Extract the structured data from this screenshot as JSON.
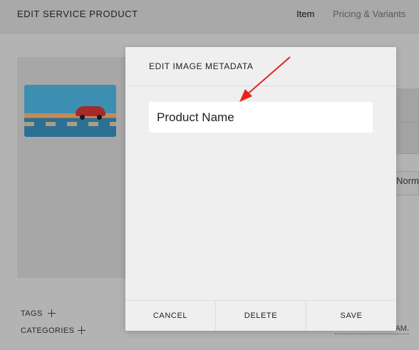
{
  "page": {
    "title": "EDIT SERVICE PRODUCT",
    "tabs": [
      {
        "label": "Item",
        "active": true
      },
      {
        "label": "Pricing & Variants",
        "active": false
      }
    ],
    "partial_right_text": "Norm",
    "tags_label": "TAGS",
    "categories_label": "CATEGORIES",
    "partial_link_text": "AM."
  },
  "modal": {
    "title": "EDIT IMAGE METADATA",
    "name_field": {
      "value": "Product Name"
    },
    "buttons": {
      "cancel": "CANCEL",
      "delete": "DELETE",
      "save": "SAVE"
    }
  },
  "colors": {
    "overlay": "#b3b3b3",
    "modal_bg": "#efefef",
    "annotation_arrow": "#e8231b"
  },
  "icons": [
    "plus-icon",
    "annotation-arrow"
  ]
}
